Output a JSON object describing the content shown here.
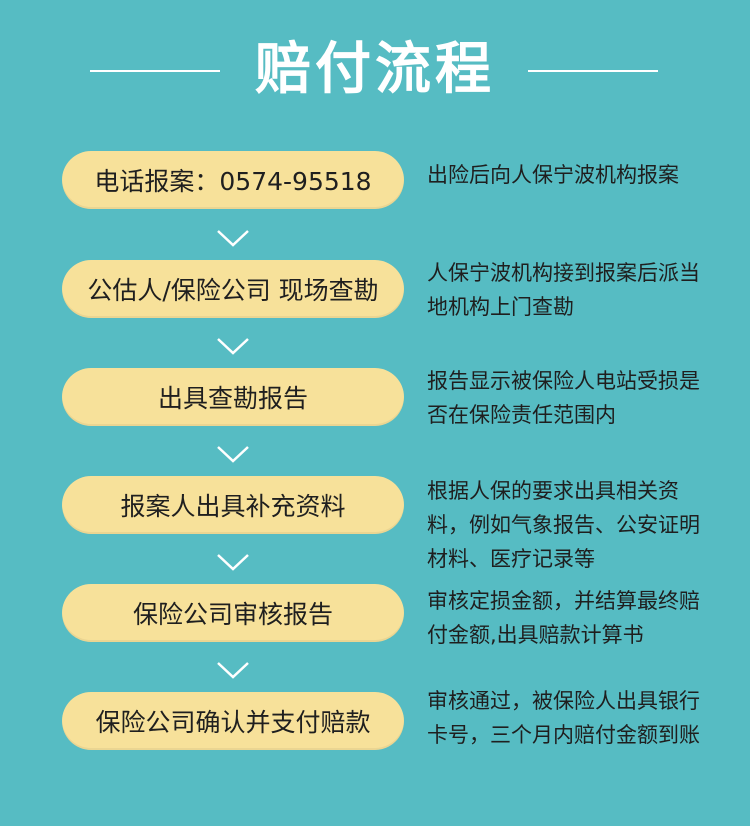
{
  "title": "赔付流程",
  "steps": [
    {
      "label": "电话报案：0574-95518",
      "desc": "出险后向人保宁波机构报案"
    },
    {
      "label": "公估人/保险公司 现场查勘",
      "desc": "人保宁波机构接到报案后派当地机构上门查勘"
    },
    {
      "label": "出具查勘报告",
      "desc": "报告显示被保险人电站受损是否在保险责任范围内"
    },
    {
      "label": "报案人出具补充资料",
      "desc": "根据人保的要求出具相关资料，例如气象报告、公安证明材料、医疗记录等"
    },
    {
      "label": "保险公司审核报告",
      "desc": "审核定损金额，并结算最终赔付金额,出具赔款计算书"
    },
    {
      "label": "保险公司确认并支付赔款",
      "desc": "审核通过，被保险人出具银行卡号，三个月内赔付金额到账"
    }
  ],
  "colors": {
    "background": "#56bcc3",
    "pill": "#f7e19a",
    "text": "#1f1f1f",
    "title": "#ffffff"
  },
  "icons": {
    "separator": "chevron-down-icon"
  }
}
